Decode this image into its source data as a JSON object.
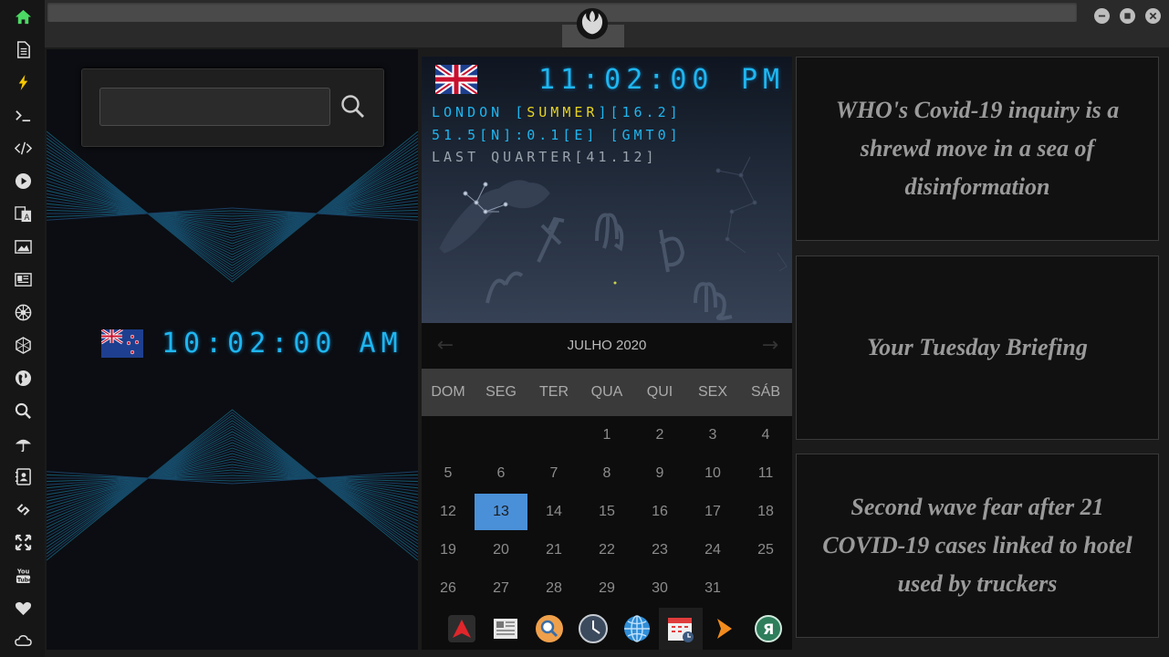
{
  "sidebar": {
    "items": [
      {
        "icon": "home-icon",
        "color": "#4cd964"
      },
      {
        "icon": "document-icon"
      },
      {
        "icon": "lightning-icon",
        "color": "#f7c700"
      },
      {
        "icon": "terminal-icon"
      },
      {
        "icon": "code-icon"
      },
      {
        "icon": "play-icon"
      },
      {
        "icon": "translate-icon"
      },
      {
        "icon": "image-icon"
      },
      {
        "icon": "news-icon"
      },
      {
        "icon": "empire-icon"
      },
      {
        "icon": "hexagon-icon"
      },
      {
        "icon": "globe-icon"
      },
      {
        "icon": "search-icon"
      },
      {
        "icon": "umbrella-icon"
      },
      {
        "icon": "contacts-icon"
      },
      {
        "icon": "link-icon"
      },
      {
        "icon": "expand-icon"
      },
      {
        "icon": "youtube-icon",
        "label": "You Tube"
      },
      {
        "icon": "heart-icon"
      },
      {
        "icon": "cloud-icon"
      }
    ]
  },
  "topbar": {
    "logo": "rebel-alliance-icon"
  },
  "search": {
    "value": "",
    "placeholder": ""
  },
  "clock_nz": {
    "time": "10:02:00 AM",
    "flag": "new-zealand-flag"
  },
  "clock_uk": {
    "time": "11:02:00",
    "ampm": "PM",
    "flag": "united-kingdom-flag",
    "line1_prefix": "LONDON [",
    "line1_season": "SUMMER",
    "line1_suffix": "][16.2]",
    "line2": "51.5[N]:0.1[E] [GMT0]",
    "line3": "LAST QUARTER[41.12]"
  },
  "calendar": {
    "month": "JULHO 2020",
    "prev": "←",
    "next": "→",
    "weekdays": [
      "DOM",
      "SEG",
      "TER",
      "QUA",
      "QUI",
      "SEX",
      "SÁB"
    ],
    "days": [
      "",
      "",
      "",
      "1",
      "2",
      "3",
      "4",
      "5",
      "6",
      "7",
      "8",
      "9",
      "10",
      "11",
      "12",
      "13",
      "14",
      "15",
      "16",
      "17",
      "18",
      "19",
      "20",
      "21",
      "22",
      "23",
      "24",
      "25",
      "26",
      "27",
      "28",
      "29",
      "30",
      "31",
      ""
    ],
    "selected": "13"
  },
  "dock": [
    "arch-icon",
    "newspaper-icon",
    "search-app-icon",
    "clock-app-icon",
    "globe-app-icon",
    "calendar-app-icon",
    "arrow-app-icon",
    "yandex-icon"
  ],
  "news": [
    {
      "headline": "WHO's Covid-19 inquiry is a shrewd move in a sea of disinformation"
    },
    {
      "headline": "Your Tuesday Briefing"
    },
    {
      "headline": "Second wave fear after 21 COVID-19 cases linked to hotel used by truckers"
    }
  ]
}
